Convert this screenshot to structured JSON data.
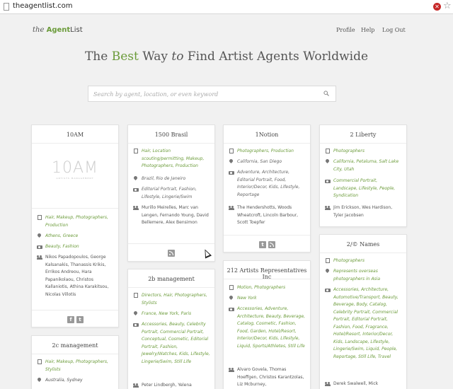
{
  "browser": {
    "url": "theagentlist.com"
  },
  "header": {
    "logo_the": "the",
    "logo_agent": "Agent",
    "logo_list": "List",
    "nav": {
      "profile": "Profile",
      "help": "Help",
      "logout": "Log Out"
    }
  },
  "headline": {
    "part1": "The ",
    "best": "Best",
    "part2": " Way ",
    "to": "to",
    "part3": " Find Artist Agents Worldwide"
  },
  "search": {
    "placeholder": "Search by agent, location, or even keyword"
  },
  "cards": {
    "c10am": {
      "title": "10AM",
      "logo_text": "10AM",
      "logo_sub": "ARTISTS MANAGEMENT",
      "categories": "Hair, Makeup, Photographers, Production",
      "location": "Athens, Greece",
      "specialties": "Beauty, Fashion",
      "artists": "Nikos Papadopoulos, George Kalsanakis, Thanassis Krikis, Errikos Andreou, Hara Papanikolaou, Christos Kallaniotis, Athina Karakitsou, Nicolas Villotis"
    },
    "c1500": {
      "title": "1500 Brasil",
      "categories": "Hair, Location scouting/permitting, Makeup, Photographers, Production",
      "location": "Brazil, Rio de Janeiro",
      "specialties": "Editorial Portrait, Fashion, Lifestyle, Lingerie/Swim",
      "artists": "Murillo Meirelles, Marc van Lengen, Fernando Young, David Bellemere, Alex Bensimon"
    },
    "c1notion": {
      "title": "1Notion",
      "categories": "Photographers, Production",
      "location": "California, San Diego",
      "specialties": "Adventure, Architecture, Editorial Portrait, Food, Interior/Decor, Kids, Lifestyle, Reportage",
      "artists": "The Hendershotts, Woods Wheatcroft, Lincoln Barbour, Scott Toepfer"
    },
    "c2liberty": {
      "title": "2 Liberty",
      "categories": "Photographers",
      "location": "California, Petaluma, Salt Lake City, Utah",
      "specialties": "Commercial Portrait, Landscape, Lifestyle, People, Syndication",
      "artists": "Jim Erickson, Wes Hardison, Tyler Jacobsen"
    },
    "c2b": {
      "title": "2b management",
      "categories": "Directors, Hair, Photographers, Stylists",
      "location": "France, New York, Paris",
      "specialties": "Accessories, Beauty, Celebrity Portrait, Commercial Portrait, Conceptual, Cosmetic, Editorial Portrait, Fashion, Jewelry/Watches, Kids, Lifestyle, Lingerie/Swim, Still Life",
      "artists": "Peter Lindbergh, Yelena"
    },
    "c212": {
      "title": "212 Artists Representatives Inc",
      "categories": "Motion, Photographers",
      "location": "New York",
      "specialties": "Accessories, Adventure, Architecture, Beauty, Beverage, Catalog, Cosmetic, Fashion, Food, Garden, Hotel/Resort, Interior/Decor, Kids, Lifestyle, Liquid, Sports/Athletes, Still Life",
      "artists": "Alvaro Govela, Thomas Hoeffgen, Christos Karantzolas, Liz Mcburney,"
    },
    "c2names": {
      "title": "2/© Names",
      "categories": "Photographers",
      "location": "Represents overseas photographers in Asia",
      "specialties": "Accessories, Architecture, Automotive/Transport, Beauty, Beverage, Body, Catalog, Celebrity Portrait, Commercial Portrait, Editorial Portrait, Fashion, Food, Fragrance, Hotel/Resort, Interior/Decor, Kids, Landscape, Lifestyle, Lingerie/Swim, Liquid, People, Reportage, Still Life, Travel",
      "artists": "Derek Swalwell, Mick"
    },
    "c2c": {
      "title": "2c management",
      "categories": "Hair, Makeup, Photographers, Stylists",
      "location": "Australia, Sydney"
    }
  }
}
